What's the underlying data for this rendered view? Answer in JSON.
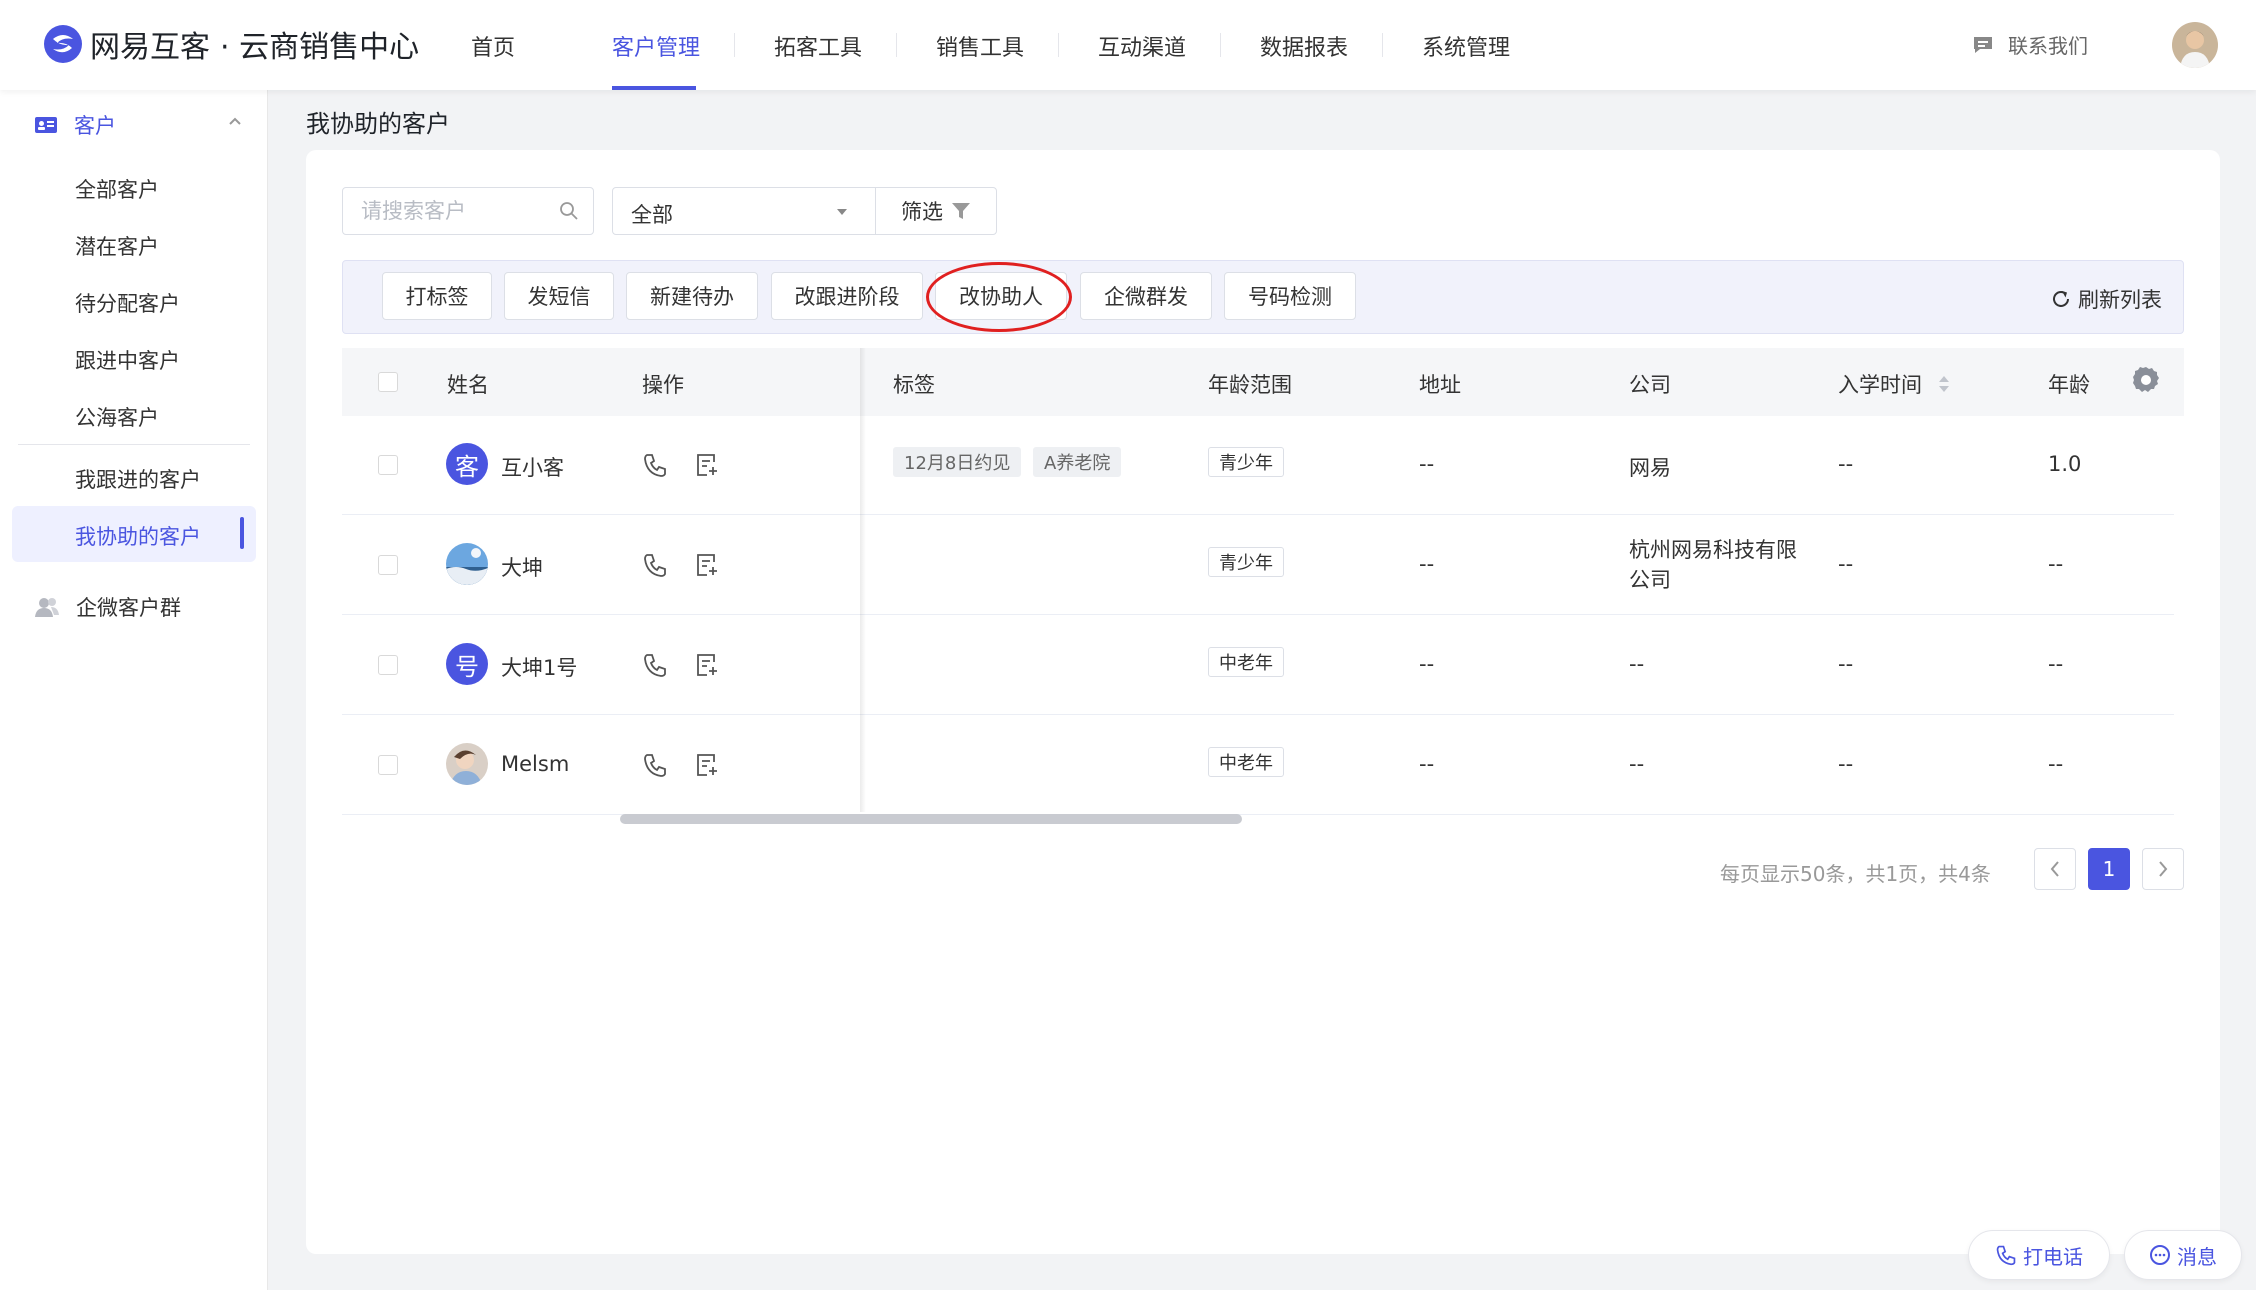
{
  "header": {
    "brand": "网易互客",
    "brand_sub": "· 云商销售中心",
    "nav": [
      "首页",
      "客户管理",
      "拓客工具",
      "销售工具",
      "互动渠道",
      "数据报表",
      "系统管理"
    ],
    "active_nav": "客户管理",
    "contact": "联系我们"
  },
  "sidebar": {
    "group_customers": "客户",
    "items": [
      "全部客户",
      "潜在客户",
      "待分配客户",
      "跟进中客户",
      "公海客户",
      "我跟进的客户",
      "我协助的客户"
    ],
    "active_item": "我协助的客户",
    "group_wecom": "企微客户群"
  },
  "page": {
    "title": "我协助的客户"
  },
  "filters": {
    "search_placeholder": "请搜索客户",
    "select_value": "全部",
    "filter_label": "筛选"
  },
  "toolbar": {
    "buttons": [
      "打标签",
      "发短信",
      "新建待办",
      "改跟进阶段",
      "改协助人",
      "企微群发",
      "号码检测"
    ],
    "highlighted": "改协助人",
    "refresh": "刷新列表"
  },
  "table": {
    "columns": [
      "姓名",
      "操作",
      "标签",
      "年龄范围",
      "地址",
      "公司",
      "入学时间",
      "年龄"
    ],
    "rows": [
      {
        "avatar": "客",
        "name": "互小客",
        "tags": [
          "12月8日约见",
          "A养老院"
        ],
        "age_range": "青少年",
        "address": "--",
        "company": "网易",
        "enroll": "--",
        "age": "1.0"
      },
      {
        "avatar": "",
        "name": "大坤",
        "tags": [],
        "age_range": "青少年",
        "address": "--",
        "company": "杭州网易科技有限公司",
        "enroll": "--",
        "age": "--"
      },
      {
        "avatar": "号",
        "name": "大坤1号",
        "tags": [],
        "age_range": "中老年",
        "address": "--",
        "company": "--",
        "enroll": "--",
        "age": "--"
      },
      {
        "avatar": "",
        "name": "Melsm",
        "tags": [],
        "age_range": "中老年",
        "address": "--",
        "company": "--",
        "enroll": "--",
        "age": "--"
      }
    ]
  },
  "pagination": {
    "summary": "每页显示50条，共1页，共4条",
    "current_page": "1"
  },
  "float_actions": {
    "call": "打电话",
    "message": "消息"
  },
  "colors": {
    "accent": "#4a55e0",
    "highlight_ring": "#e02020"
  }
}
